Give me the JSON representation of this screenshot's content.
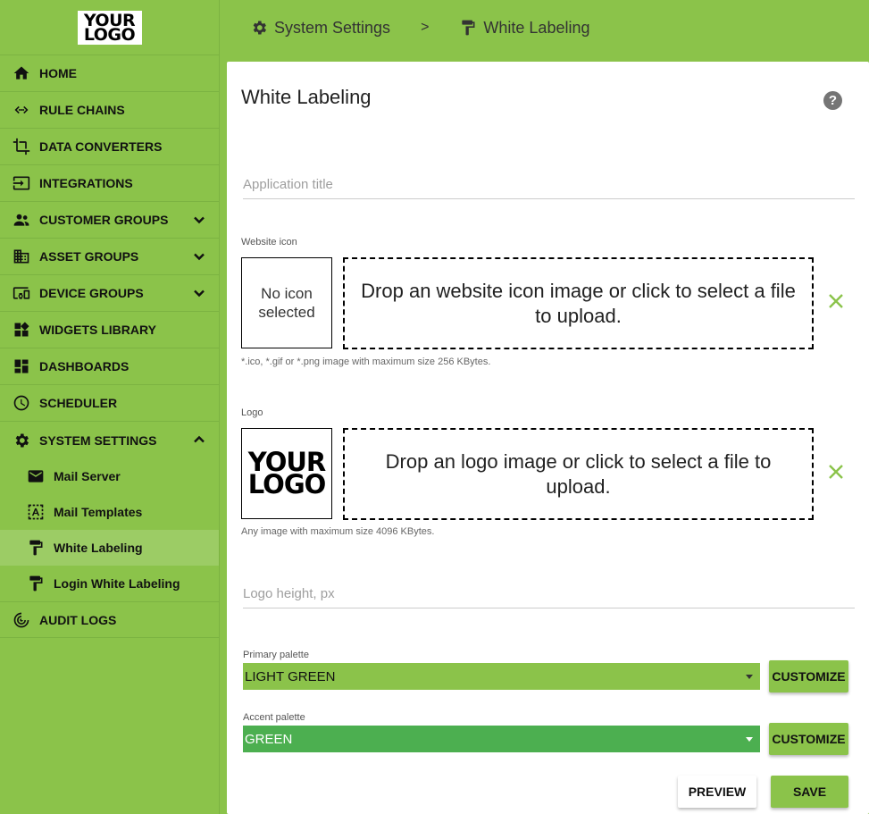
{
  "colors": {
    "primary": "#8bc34a",
    "primary_light": "#9ccc65",
    "accent": "#4caf50",
    "text": "#212121"
  },
  "sidebar": {
    "logo": {
      "line1": "YOUR",
      "line2": "LOGO"
    },
    "items": [
      {
        "label": "HOME",
        "icon": "home-icon"
      },
      {
        "label": "RULE CHAINS",
        "icon": "code-arrows-icon"
      },
      {
        "label": "DATA CONVERTERS",
        "icon": "crop-icon"
      },
      {
        "label": "INTEGRATIONS",
        "icon": "input-icon"
      },
      {
        "label": "CUSTOMER GROUPS",
        "icon": "people-icon",
        "expand": "down"
      },
      {
        "label": "ASSET GROUPS",
        "icon": "building-icon",
        "expand": "down"
      },
      {
        "label": "DEVICE GROUPS",
        "icon": "devices-icon",
        "expand": "down"
      },
      {
        "label": "WIDGETS LIBRARY",
        "icon": "widgets-icon"
      },
      {
        "label": "DASHBOARDS",
        "icon": "dashboard-icon"
      },
      {
        "label": "SCHEDULER",
        "icon": "clock-icon"
      },
      {
        "label": "SYSTEM SETTINGS",
        "icon": "gear-icon",
        "expand": "up"
      }
    ],
    "sub_items": [
      {
        "label": "Mail Server",
        "icon": "mail-icon"
      },
      {
        "label": "Mail Templates",
        "icon": "template-icon"
      },
      {
        "label": "White Labeling",
        "icon": "paint-roller-icon",
        "active": true
      },
      {
        "label": "Login White Labeling",
        "icon": "paint-roller-icon"
      }
    ],
    "last_item": {
      "label": "AUDIT LOGS",
      "icon": "radar-icon"
    }
  },
  "header": {
    "crumb1": "System Settings",
    "separator": ">",
    "crumb2": "White Labeling"
  },
  "card": {
    "title": "White Labeling",
    "help": "?",
    "app_title_placeholder": "Application title",
    "website_icon": {
      "label": "Website icon",
      "preview_line1": "No icon",
      "preview_line2": "selected",
      "drop_text": "Drop an website icon image or click to select a file to upload.",
      "hint": "*.ico, *.gif or *.png image with maximum size 256 KBytes."
    },
    "logo": {
      "label": "Logo",
      "preview_line1": "YOUR",
      "preview_line2": "LOGO",
      "drop_text": "Drop an logo image or click to select a file to upload.",
      "hint": "Any image with maximum size 4096 KBytes."
    },
    "logo_height_placeholder": "Logo height, px",
    "primary_palette": {
      "label": "Primary palette",
      "value": "LIGHT GREEN",
      "button": "CUSTOMIZE"
    },
    "accent_palette": {
      "label": "Accent palette",
      "value": "GREEN",
      "button": "CUSTOMIZE"
    },
    "preview_button": "PREVIEW",
    "save_button": "SAVE"
  }
}
